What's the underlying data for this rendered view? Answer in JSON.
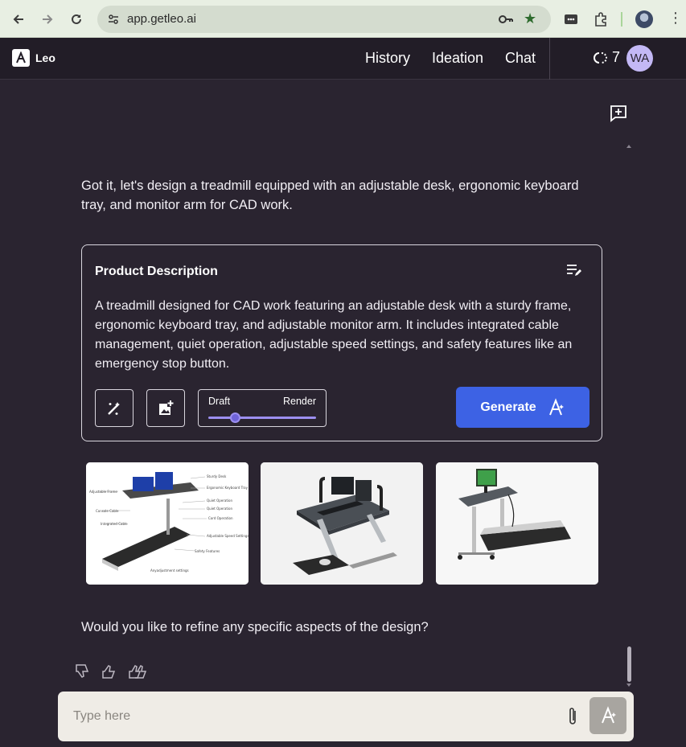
{
  "browser": {
    "url": "app.getleo.ai"
  },
  "header": {
    "logo_text": "Leo",
    "nav": [
      "History",
      "Ideation",
      "Chat"
    ],
    "credits": "7",
    "avatar_initials": "WA"
  },
  "chat": {
    "assistant_intro": "Got it, let's design a treadmill equipped with an adjustable desk, ergonomic keyboard tray, and monitor arm for CAD work.",
    "product_card": {
      "title": "Product Description",
      "description": "A treadmill designed for CAD work featuring an adjustable desk with a sturdy frame, ergonomic keyboard tray, and adjustable monitor arm. It includes integrated cable management, quiet operation, adjustable speed settings, and safety features like an emergency stop button.",
      "quality_min_label": "Draft",
      "quality_max_label": "Render",
      "quality_level": 0.25,
      "generate_label": "Generate"
    },
    "follow_up": "Would you like to refine any specific aspects of the design?"
  },
  "composer": {
    "placeholder": "Type here"
  },
  "colors": {
    "background": "#2a2430",
    "header": "#221d27",
    "accent_button": "#3d62e4",
    "slider": "#9c8ff0",
    "avatar": "#c3b8f5"
  },
  "icons": [
    "back-icon",
    "forward-icon",
    "reload-icon",
    "site-settings-icon",
    "key-icon",
    "bookmark-star-icon",
    "extension-icon",
    "puzzle-icon",
    "new-chat-icon",
    "edit-notes-icon",
    "magic-wand-icon",
    "add-image-icon",
    "leo-logo-icon",
    "thumbs-down-icon",
    "thumbs-up-icon",
    "double-thumbs-up-icon",
    "paperclip-icon",
    "credits-icon"
  ]
}
